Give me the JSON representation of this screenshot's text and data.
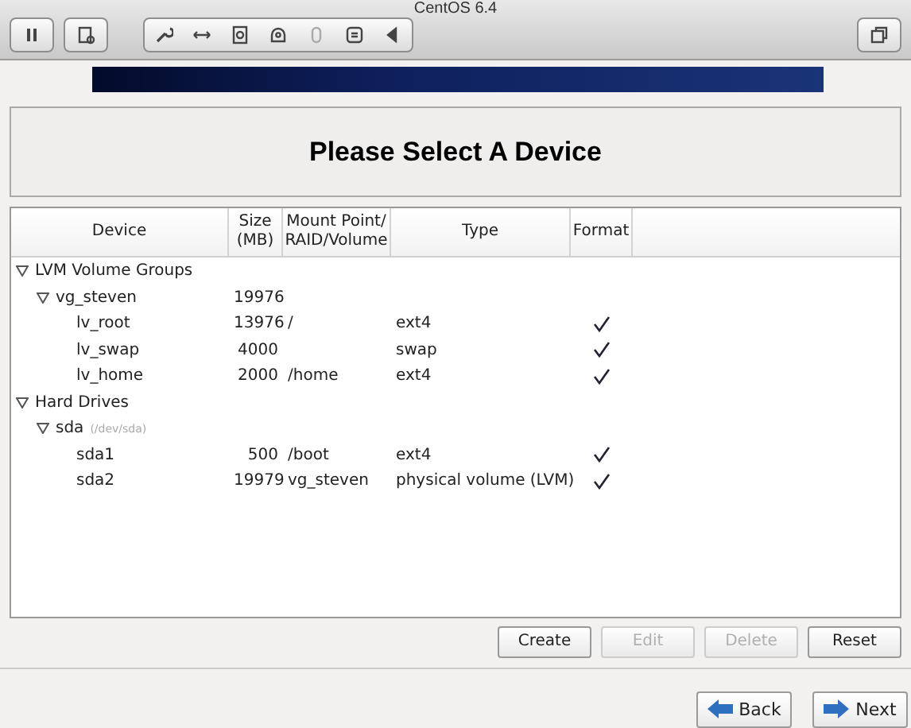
{
  "window": {
    "title": "CentOS 6.4"
  },
  "heading": "Please Select A Device",
  "table": {
    "columns": [
      "Device",
      "Size\n(MB)",
      "Mount Point/\nRAID/Volume",
      "Type",
      "Format"
    ],
    "rows": [
      {
        "device": "LVM Volume Groups",
        "expanded": true,
        "children": [
          {
            "device": "vg_steven",
            "size": "19976",
            "expanded": true,
            "children": [
              {
                "device": "lv_root",
                "size": "13976",
                "mount": "/",
                "type": "ext4",
                "format": true
              },
              {
                "device": "lv_swap",
                "size": "4000",
                "type": "swap",
                "format": true
              },
              {
                "device": "lv_home",
                "size": "2000",
                "mount": "/home",
                "type": "ext4",
                "format": true
              }
            ]
          }
        ]
      },
      {
        "device": "Hard Drives",
        "expanded": true,
        "children": [
          {
            "device": "sda",
            "note": "(/dev/sda)",
            "expanded": true,
            "children": [
              {
                "device": "sda1",
                "size": "500",
                "mount": "/boot",
                "type": "ext4",
                "format": true
              },
              {
                "device": "sda2",
                "size": "19979",
                "mount": "vg_steven",
                "type": "physical volume (LVM)",
                "format": true
              }
            ]
          }
        ]
      }
    ]
  },
  "actions": [
    {
      "label": "Create",
      "disabled": false
    },
    {
      "label": "Edit",
      "disabled": true
    },
    {
      "label": "Delete",
      "disabled": true
    },
    {
      "label": "Reset",
      "disabled": false
    }
  ],
  "nav": [
    {
      "label": "Back",
      "kind": "back"
    },
    {
      "label": "Next",
      "kind": "next"
    }
  ]
}
